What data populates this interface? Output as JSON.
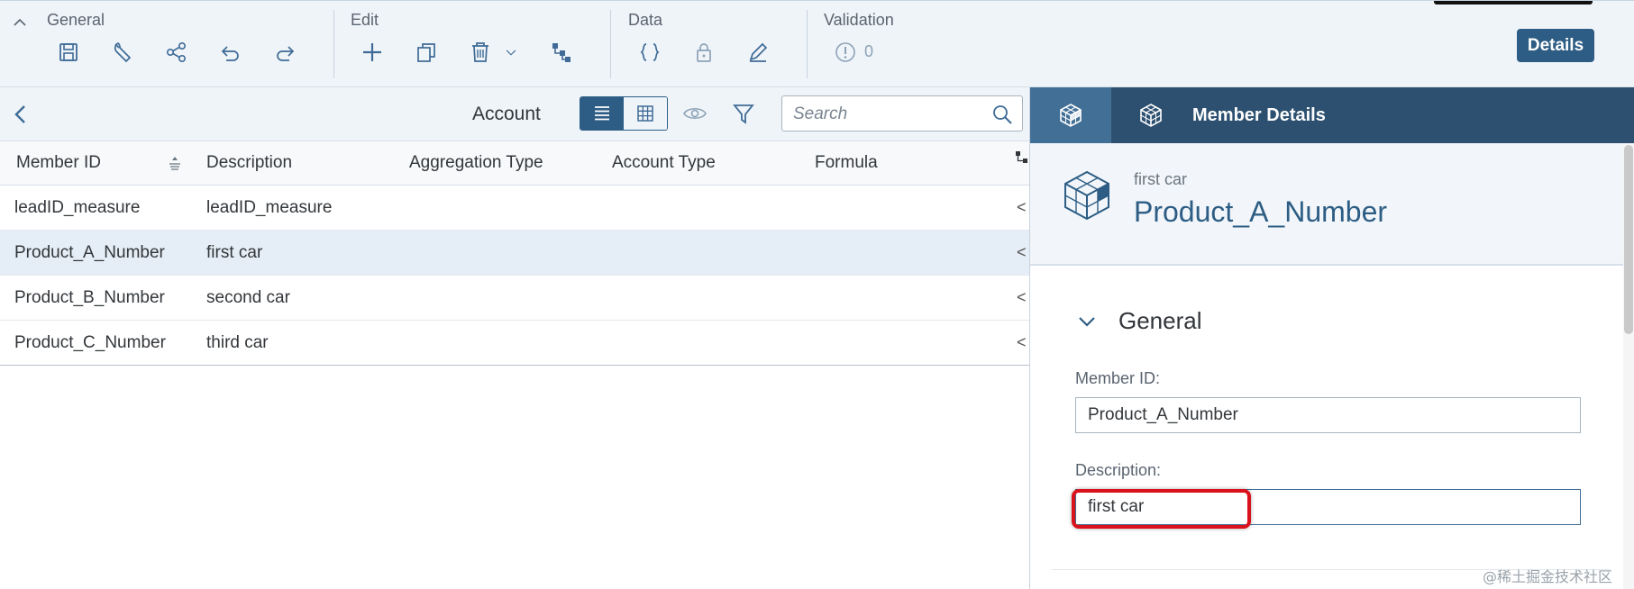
{
  "toolbar": {
    "groups": {
      "general": "General",
      "edit": "Edit",
      "data": "Data",
      "validation": "Validation"
    },
    "icons": {
      "general": [
        "save-icon",
        "wrench-icon",
        "share-icon",
        "undo-icon",
        "redo-icon"
      ],
      "edit": [
        "add-icon",
        "copy-icon",
        "delete-icon",
        "chevron-down-icon",
        "hierarchy-icon"
      ],
      "data": [
        "formula-braces-icon",
        "lock-icon",
        "edit-pen-icon"
      ],
      "validation": [
        "alert-circle-icon"
      ]
    },
    "validation_count": "0",
    "details_label": "Details"
  },
  "subheader": {
    "title": "Account",
    "view_modes": [
      "list-view-icon",
      "grid-view-icon"
    ],
    "selected_view": "list-view-icon",
    "search_placeholder": "Search"
  },
  "table": {
    "columns": [
      "Member ID",
      "Description",
      "Aggregation Type",
      "Account Type",
      "Formula"
    ],
    "rows": [
      {
        "member_id": "leadID_measure",
        "description": "leadID_measure",
        "more": "<"
      },
      {
        "member_id": "Product_A_Number",
        "description": "first car",
        "more": "<",
        "selected": true
      },
      {
        "member_id": "Product_B_Number",
        "description": "second car",
        "more": "<"
      },
      {
        "member_id": "Product_C_Number",
        "description": "third car",
        "more": "<"
      }
    ]
  },
  "panel": {
    "tab_label": "Member Details",
    "object_subtitle": "first car",
    "object_title": "Product_A_Number",
    "section_title": "General",
    "fields": {
      "member_id_label": "Member ID:",
      "member_id_value": "Product_A_Number",
      "description_label": "Description:",
      "description_value": "first car"
    }
  },
  "watermark": "@稀土掘金技术社区",
  "colors": {
    "accent": "#2d5d84",
    "toolbar_bg": "#eff4f9",
    "panel_header_bg": "#2d5070",
    "highlight": "#d9121b"
  }
}
